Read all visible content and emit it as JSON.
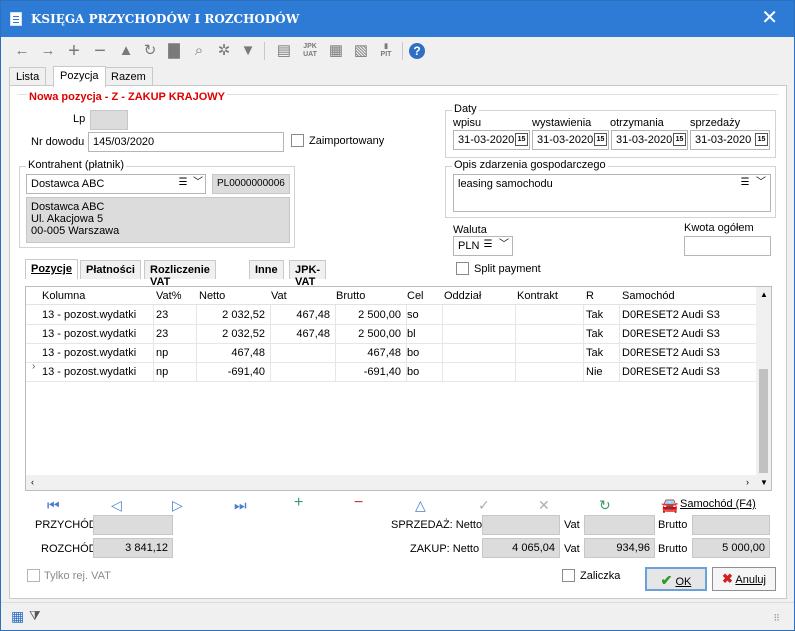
{
  "window": {
    "title": "KSIĘGA PRZYCHODÓW I ROZCHODÓW",
    "close": "✕"
  },
  "toolbar": {
    "jpk_label": "JPK\nUAT",
    "pit_label": "PIT"
  },
  "tabs": [
    "Lista",
    "Pozycja",
    "Razem"
  ],
  "form": {
    "header": "Nowa pozycja - Z - ZAKUP KRAJOWY",
    "lp_label": "Lp",
    "lp_value": "",
    "nr_label": "Nr dowodu",
    "nr_value": "145/03/2020",
    "zaimport_label": "Zaimportowany"
  },
  "daty": {
    "label": "Daty",
    "wpisu": "wpisu",
    "wystawienia": "wystawienia",
    "otrzymania": "otrzymania",
    "sprzedazy": "sprzedaży",
    "d1": "31-03-2020",
    "d2": "31-03-2020",
    "d3": "31-03-2020",
    "d4": "31-03-2020",
    "cal": "15"
  },
  "kontrahent": {
    "label": "Kontrahent (płatnik)",
    "name": "Dostawca ABC",
    "nip": "PL0000000006",
    "addr1": "Dostawca ABC",
    "addr2": "Ul. Akacjowa 5",
    "addr3": "00-005 Warszawa"
  },
  "opis": {
    "label": "Opis zdarzenia gospodarczego",
    "value": "leasing samochodu"
  },
  "waluta": {
    "label": "Waluta",
    "value": "PLN"
  },
  "kwota": {
    "label": "Kwota ogółem",
    "value": ""
  },
  "split_label": "Split payment",
  "subtabs": [
    "Pozycje",
    "Płatności",
    "Rozliczenie VAT",
    "Inne",
    "JPK-VAT"
  ],
  "grid": {
    "headers": [
      "Kolumna",
      "Vat%",
      "Netto",
      "Vat",
      "Brutto",
      "Cel",
      "Oddział",
      "Kontrakt",
      "R",
      "Samochód"
    ],
    "rows": [
      [
        "13 - pozost.wydatki",
        "23",
        "2 032,52",
        "467,48",
        "2 500,00",
        "so",
        "",
        "",
        "Tak",
        "D0RESET2 Audi S3"
      ],
      [
        "13 - pozost.wydatki",
        "23",
        "2 032,52",
        "467,48",
        "2 500,00",
        "bl",
        "",
        "",
        "Tak",
        "D0RESET2 Audi S3"
      ],
      [
        "13 - pozost.wydatki",
        "np",
        "467,48",
        "",
        "467,48",
        "bo",
        "",
        "",
        "Tak",
        "D0RESET2 Audi S3"
      ],
      [
        "13 - pozost.wydatki",
        "np",
        "-691,40",
        "",
        "-691,40",
        "bo",
        "",
        "",
        "Nie",
        "D0RESET2 Audi S3"
      ]
    ]
  },
  "samochod_btn": "Samochód (F4)",
  "totals": {
    "przychod_label": "PRZYCHÓD",
    "przychod": "",
    "rozchod_label": "ROZCHÓD",
    "rozchod": "3 841,12",
    "sprzedaz_label": "SPRZEDAŻ: Netto",
    "sprzedaz_netto": "",
    "zakup_label": "ZAKUP: Netto",
    "zakup_netto": "4 065,04",
    "vat_label": "Vat",
    "sprzedaz_vat": "",
    "zakup_vat": "934,96",
    "brutto_label": "Brutto",
    "sprzedaz_brutto": "",
    "zakup_brutto": "5 000,00"
  },
  "footer": {
    "tylko_vat": "Tylko rej. VAT",
    "zaliczka": "Zaliczka",
    "ok": "OK",
    "anuluj": "Anuluj"
  }
}
